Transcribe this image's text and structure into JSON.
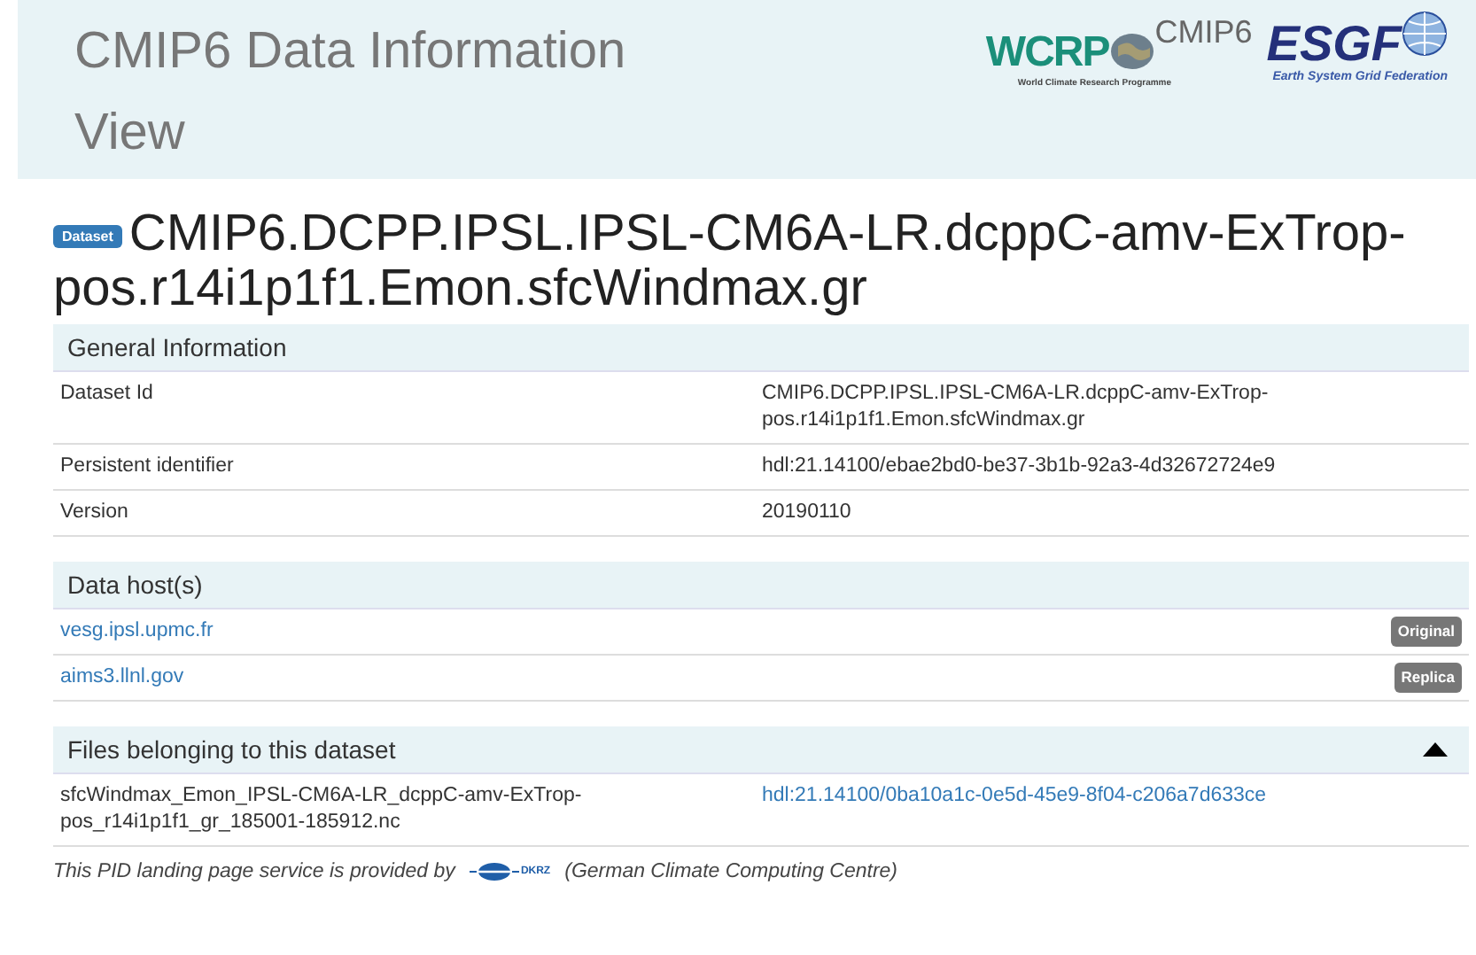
{
  "header": {
    "title": "CMIP6 Data Information View",
    "logos": {
      "wcrp": "WCRP",
      "wcrp_caption": "World Climate Research Programme",
      "cmip": "CMIP6",
      "esgf": "ESGF",
      "esgf_caption": "Earth System Grid Federation"
    }
  },
  "dataset": {
    "badge": "Dataset",
    "name": "CMIP6.DCPP.IPSL.IPSL-CM6A-LR.dcppC-amv-ExTrop-pos.r14i1p1f1.Emon.sfcWindmax.gr"
  },
  "general": {
    "title": "General Information",
    "rows": [
      {
        "label": "Dataset Id",
        "value": "CMIP6.DCPP.IPSL.IPSL-CM6A-LR.dcppC-amv-ExTrop-pos.r14i1p1f1.Emon.sfcWindmax.gr"
      },
      {
        "label": "Persistent identifier",
        "value": "hdl:21.14100/ebae2bd0-be37-3b1b-92a3-4d32672724e9"
      },
      {
        "label": "Version",
        "value": "20190110"
      }
    ]
  },
  "hosts": {
    "title": "Data host(s)",
    "rows": [
      {
        "host": "vesg.ipsl.upmc.fr",
        "tag": "Original"
      },
      {
        "host": "aims3.llnl.gov",
        "tag": "Replica"
      }
    ]
  },
  "files": {
    "title": "Files belonging to this dataset",
    "expanded": true,
    "rows": [
      {
        "name": "sfcWindmax_Emon_IPSL-CM6A-LR_dcppC-amv-ExTrop-pos_r14i1p1f1_gr_185001-185912.nc",
        "handle": "hdl:21.14100/0ba10a1c-0e5d-45e9-8f04-c206a7d633ce"
      }
    ]
  },
  "footer": {
    "before": "This PID landing page service is provided by",
    "logo": "DKRZ",
    "after": "(German Climate Computing Centre)"
  }
}
